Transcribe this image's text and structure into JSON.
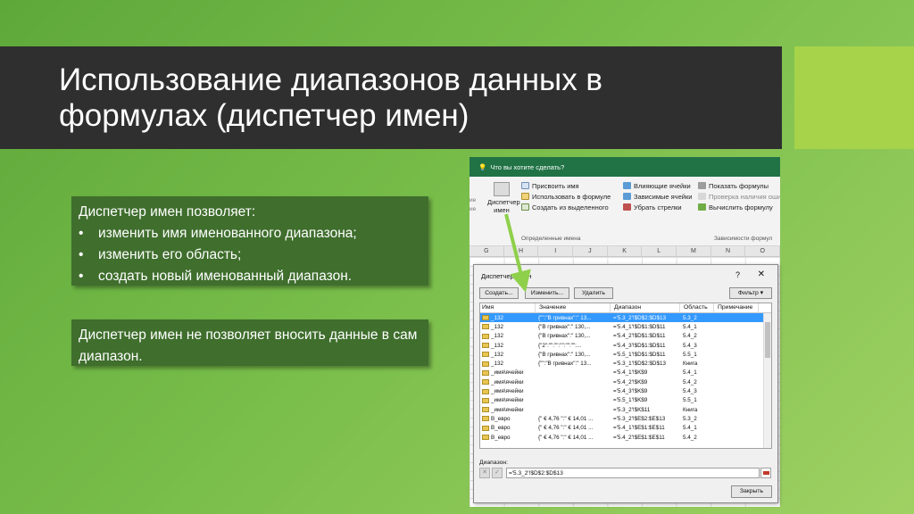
{
  "slide": {
    "title": "Использование диапазонов данных в формулах (диспетчер имен)",
    "box1": {
      "heading": "Диспетчер имен позволяет:",
      "bullets": [
        "изменить имя именованного диапазона;",
        "изменить его область;",
        "создать новый именованный диапазон."
      ],
      "bullet_char": "•"
    },
    "box2": {
      "text": "Диспетчер имен не позволяет вносить данные в сам диапазон."
    }
  },
  "excel": {
    "tell_me": "Что вы хотите сделать?",
    "left_partial": [
      "ие",
      "ие"
    ],
    "name_manager_big": "Диспетчер имен",
    "defined_names": [
      "Присвоить имя",
      "Использовать в формуле",
      "Создать из выделенного"
    ],
    "defined_names_label": "Определенные имена",
    "audit_col1": [
      "Влияющие ячейки",
      "Зависимые ячейки",
      "Убрать стрелки"
    ],
    "audit_col2": [
      "Показать формулы",
      "Проверка наличия оши",
      "Вычислить формулу"
    ],
    "audit_label": "Зависимости формул",
    "columns": [
      "G",
      "H",
      "I",
      "J",
      "K",
      "L",
      "M",
      "N",
      "O"
    ]
  },
  "dialog": {
    "title": "Диспетчер имен",
    "help": "?",
    "close_x": "✕",
    "buttons": {
      "create": "Создать...",
      "edit": "Изменить...",
      "delete": "Удалить",
      "filter": "Фильтр ▾"
    },
    "headers": [
      "Имя",
      "Значение",
      "Диапазон",
      "Область",
      "Примечание"
    ],
    "rows": [
      {
        "name": "_132",
        "value": "{\"\":\"В гривнах\":\" 13...",
        "range": "='5.3_2'!$D$2:$D$13",
        "scope": "5.3_2",
        "selected": true
      },
      {
        "name": "_132",
        "value": "{\"В гривнах\":\" 130,...",
        "range": "='5.4_1'!$D$1:$D$11",
        "scope": "5.4_1"
      },
      {
        "name": "_132",
        "value": "{\"В гривнах\":\" 130,...",
        "range": "='5.4_2'!$D$1:$D$11",
        "scope": "5.4_2"
      },
      {
        "name": "_132",
        "value": "{\"2\":\"\":\"\":\"\":\"\":\"\":...",
        "range": "='5.4_3'!$D$1:$D$11",
        "scope": "5.4_3"
      },
      {
        "name": "_132",
        "value": "{\"В гривнах\":\" 130,...",
        "range": "='5.5_1'!$D$1:$D$11",
        "scope": "5.5_1"
      },
      {
        "name": "_132",
        "value": "{\"\":\"В гривнах\":\" 13...",
        "range": "='5.3_1'!$D$2:$D$13",
        "scope": "Книга"
      },
      {
        "name": "_имя\\ячейки",
        "value": "",
        "range": "='5.4_1'!$K$9",
        "scope": "5.4_1"
      },
      {
        "name": "_имя\\ячейки",
        "value": "",
        "range": "='5.4_2'!$K$9",
        "scope": "5.4_2"
      },
      {
        "name": "_имя\\ячейки",
        "value": "",
        "range": "='5.4_3'!$K$9",
        "scope": "5.4_3"
      },
      {
        "name": "_имя\\ячейки",
        "value": "",
        "range": "='5.5_1'!$K$9",
        "scope": "5.5_1"
      },
      {
        "name": "_имя\\ячейки",
        "value": "",
        "range": "='5.3_2'!$K$11",
        "scope": "Книга"
      },
      {
        "name": "B_евро",
        "value": "{\" € 4,76 \":\" € 14,01 ...",
        "range": "='5.3_2'!$E$2:$E$13",
        "scope": "5.3_2"
      },
      {
        "name": "B_евро",
        "value": "{\" € 4,76 \":\" € 14,01 ...",
        "range": "='5.4_1'!$E$1:$E$11",
        "scope": "5.4_1"
      },
      {
        "name": "B_евро",
        "value": "{\" € 4,76 \":\" € 14,01 ...",
        "range": "='5.4_2'!$E$1:$E$11",
        "scope": "5.4_2"
      }
    ],
    "range_label": "Диапазон:",
    "range_value": "='5.3_2'!$D$2:$D$13",
    "cancel_glyph": "✕",
    "ok_glyph": "✓",
    "close_button": "Закрыть"
  },
  "colors": {
    "title_bar": "#2f2f2f",
    "accent": "#a6d34a",
    "textbox": "#3f6e2d",
    "selection": "#3399ff",
    "arrow": "#8ed04a"
  }
}
